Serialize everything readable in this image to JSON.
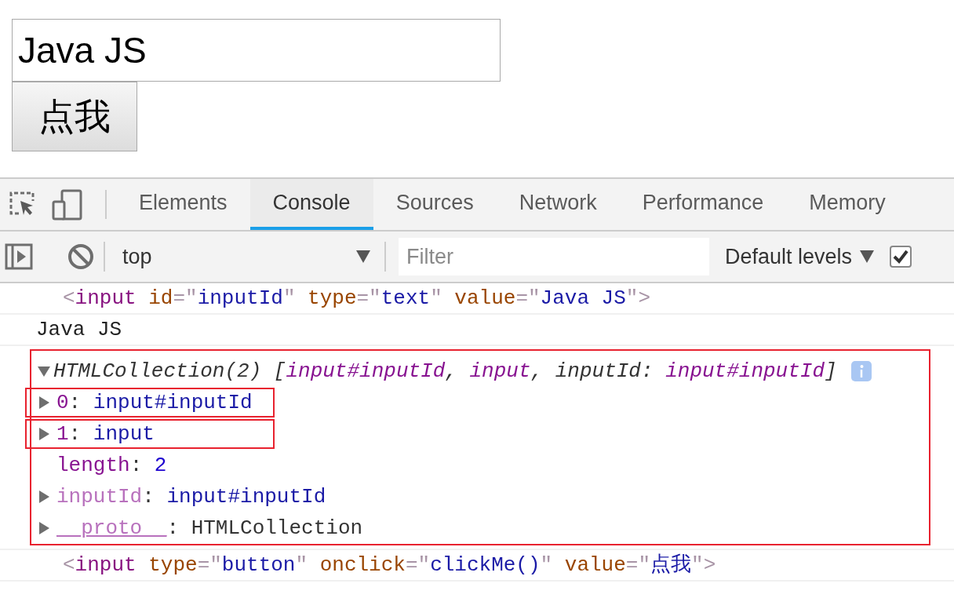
{
  "page": {
    "text_input": {
      "value": "Java JS"
    },
    "button": "点我"
  },
  "devtools": {
    "tabs": [
      {
        "label": "Elements",
        "selected": false
      },
      {
        "label": "Console",
        "selected": true
      },
      {
        "label": "Sources",
        "selected": false
      },
      {
        "label": "Network",
        "selected": false
      },
      {
        "label": "Performance",
        "selected": false
      },
      {
        "label": "Memory",
        "selected": false
      }
    ],
    "toolbar": {
      "context": "top",
      "filter": {
        "placeholder": "Filter"
      },
      "levels": "Default levels",
      "checkbox": {
        "checked": true
      }
    },
    "console": [
      {
        "kind": "element",
        "segments": [
          {
            "kind": "punct",
            "text": "<"
          },
          {
            "kind": "tag",
            "text": "input"
          },
          {
            "kind": "attr",
            "text": " id"
          },
          {
            "kind": "punct",
            "text": "=\""
          },
          {
            "kind": "value",
            "text": "inputId"
          },
          {
            "kind": "punct",
            "text": "\""
          },
          {
            "kind": "attr",
            "text": " type"
          },
          {
            "kind": "punct",
            "text": "=\""
          },
          {
            "kind": "value",
            "text": "text"
          },
          {
            "kind": "punct",
            "text": "\""
          },
          {
            "kind": "attr",
            "text": " value"
          },
          {
            "kind": "punct",
            "text": "=\""
          },
          {
            "kind": "value",
            "text": "Java JS"
          },
          {
            "kind": "punct",
            "text": "\">"
          }
        ]
      },
      {
        "kind": "log",
        "text": "Java JS"
      },
      {
        "kind": "object",
        "expanded": true,
        "highlighted": true,
        "header": [
          {
            "kind": "plain",
            "text": "HTMLCollection(2) ["
          },
          {
            "kind": "object",
            "text": "input#inputId"
          },
          {
            "kind": "plain",
            "text": ", "
          },
          {
            "kind": "object",
            "text": "input"
          },
          {
            "kind": "plain",
            "text": ", "
          },
          {
            "kind": "plain",
            "text": "inputId: "
          },
          {
            "kind": "object",
            "text": "input#inputId"
          },
          {
            "kind": "plain",
            "text": "]"
          }
        ],
        "properties": [
          {
            "segments": [
              {
                "kind": "key",
                "text": "0"
              },
              {
                "kind": "plain",
                "text": ": "
              },
              {
                "kind": "value",
                "text": "input#inputId"
              }
            ],
            "expandable": true,
            "highlighted": true
          },
          {
            "segments": [
              {
                "kind": "key",
                "text": "1"
              },
              {
                "kind": "plain",
                "text": ": "
              },
              {
                "kind": "value",
                "text": "input"
              }
            ],
            "expandable": true,
            "highlighted": true
          },
          {
            "segments": [
              {
                "kind": "key",
                "text": "length"
              },
              {
                "kind": "plain",
                "text": ": "
              },
              {
                "kind": "number",
                "text": "2"
              }
            ],
            "expandable": false,
            "highlighted": false
          },
          {
            "segments": [
              {
                "kind": "dimkey",
                "text": "inputId"
              },
              {
                "kind": "plain",
                "text": ": "
              },
              {
                "kind": "value",
                "text": "input#inputId"
              }
            ],
            "expandable": true,
            "highlighted": false
          },
          {
            "segments": [
              {
                "kind": "protokey",
                "text": "__proto__"
              },
              {
                "kind": "plain",
                "text": ": "
              },
              {
                "kind": "plain",
                "text": "HTMLCollection"
              }
            ],
            "expandable": true,
            "highlighted": false
          }
        ]
      },
      {
        "kind": "element",
        "segments": [
          {
            "kind": "punct",
            "text": "<"
          },
          {
            "kind": "tag",
            "text": "input"
          },
          {
            "kind": "attr",
            "text": " type"
          },
          {
            "kind": "punct",
            "text": "=\""
          },
          {
            "kind": "value",
            "text": "button"
          },
          {
            "kind": "punct",
            "text": "\""
          },
          {
            "kind": "attr",
            "text": " onclick"
          },
          {
            "kind": "punct",
            "text": "=\""
          },
          {
            "kind": "value",
            "text": "clickMe()"
          },
          {
            "kind": "punct",
            "text": "\""
          },
          {
            "kind": "attr",
            "text": " value"
          },
          {
            "kind": "punct",
            "text": "=\""
          },
          {
            "kind": "value",
            "text": "点我"
          },
          {
            "kind": "punct",
            "text": "\">"
          }
        ]
      }
    ]
  }
}
